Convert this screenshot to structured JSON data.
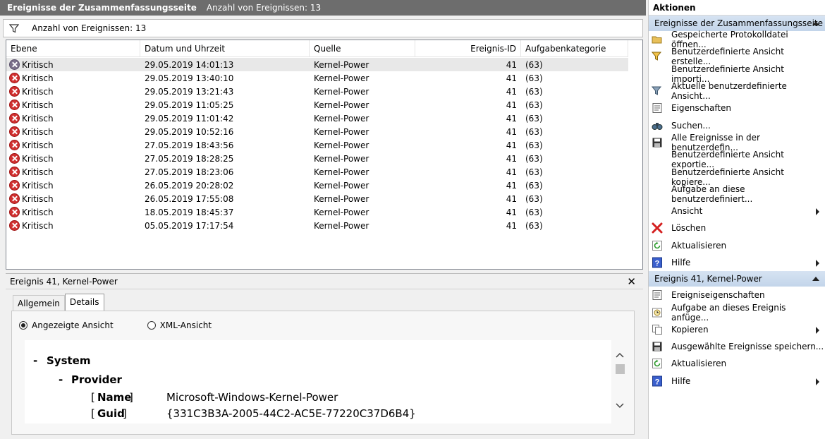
{
  "header": {
    "title": "Ereignisse der Zusammenfassungsseite",
    "count": "Anzahl von Ereignissen: 13"
  },
  "filter": {
    "text": "Anzahl von Ereignissen: 13",
    "icon": "filter-icon"
  },
  "columns": [
    "Ebene",
    "Datum und Uhrzeit",
    "Quelle",
    "Ereignis-ID",
    "Aufgabenkategorie"
  ],
  "events": [
    {
      "level": "Kritisch",
      "date": "29.05.2019 14:01:13",
      "source": "Kernel-Power",
      "id": "41",
      "category": "(63)"
    },
    {
      "level": "Kritisch",
      "date": "29.05.2019 13:40:10",
      "source": "Kernel-Power",
      "id": "41",
      "category": "(63)"
    },
    {
      "level": "Kritisch",
      "date": "29.05.2019 13:21:43",
      "source": "Kernel-Power",
      "id": "41",
      "category": "(63)"
    },
    {
      "level": "Kritisch",
      "date": "29.05.2019 11:05:25",
      "source": "Kernel-Power",
      "id": "41",
      "category": "(63)"
    },
    {
      "level": "Kritisch",
      "date": "29.05.2019 11:01:42",
      "source": "Kernel-Power",
      "id": "41",
      "category": "(63)"
    },
    {
      "level": "Kritisch",
      "date": "29.05.2019 10:52:16",
      "source": "Kernel-Power",
      "id": "41",
      "category": "(63)"
    },
    {
      "level": "Kritisch",
      "date": "27.05.2019 18:43:56",
      "source": "Kernel-Power",
      "id": "41",
      "category": "(63)"
    },
    {
      "level": "Kritisch",
      "date": "27.05.2019 18:28:25",
      "source": "Kernel-Power",
      "id": "41",
      "category": "(63)"
    },
    {
      "level": "Kritisch",
      "date": "27.05.2019 18:23:06",
      "source": "Kernel-Power",
      "id": "41",
      "category": "(63)"
    },
    {
      "level": "Kritisch",
      "date": "26.05.2019 20:28:02",
      "source": "Kernel-Power",
      "id": "41",
      "category": "(63)"
    },
    {
      "level": "Kritisch",
      "date": "26.05.2019 17:55:08",
      "source": "Kernel-Power",
      "id": "41",
      "category": "(63)"
    },
    {
      "level": "Kritisch",
      "date": "18.05.2019 18:45:37",
      "source": "Kernel-Power",
      "id": "41",
      "category": "(63)"
    },
    {
      "level": "Kritisch",
      "date": "05.05.2019 17:17:54",
      "source": "Kernel-Power",
      "id": "41",
      "category": "(63)"
    }
  ],
  "detail": {
    "title": "Ereignis 41, Kernel-Power",
    "close": "✕",
    "tabs": [
      "Allgemein",
      "Details"
    ],
    "radio_friendly": "Angezeigte Ansicht",
    "radio_xml": "XML-Ansicht",
    "xml": {
      "system_dash": "-",
      "system": "System",
      "provider_dash": "-",
      "provider": "Provider",
      "name_open": "[",
      "name_key": "Name",
      "name_close": "]",
      "name_value": "Microsoft-Windows-Kernel-Power",
      "guid_open": "[",
      "guid_key": "Guid",
      "guid_close": "]",
      "guid_value": "{331C3B3A-2005-44C2-AC5E-77220C37D6B4}"
    }
  },
  "actions": {
    "title": "Aktionen",
    "section1": {
      "title": "Ereignisse der Zusammenfassungsseite",
      "items": [
        {
          "label": "Gespeicherte Protokolldatei öffnen...",
          "icon": "folder-icon"
        },
        {
          "label": "Benutzerdefinierte Ansicht erstelle...",
          "icon": "filter-create-icon"
        },
        {
          "label": "Benutzerdefinierte Ansicht importi...",
          "icon": ""
        },
        {
          "label": "Aktuelle benutzerdefinierte Ansicht...",
          "icon": "filter-icon"
        },
        {
          "label": "Eigenschaften",
          "icon": "properties-icon"
        },
        {
          "label": "Suchen...",
          "icon": "binoculars-icon"
        },
        {
          "label": "Alle Ereignisse in der benutzerdefin...",
          "icon": "save-icon"
        },
        {
          "label": "Benutzerdefinierte Ansicht exportie...",
          "icon": ""
        },
        {
          "label": "Benutzerdefinierte Ansicht kopiere...",
          "icon": ""
        },
        {
          "label": "Aufgabe an diese benutzerdefiniert...",
          "icon": ""
        },
        {
          "label": "Ansicht",
          "icon": "",
          "submenu": true
        },
        {
          "label": "Löschen",
          "icon": "delete-icon"
        },
        {
          "label": "Aktualisieren",
          "icon": "refresh-icon"
        },
        {
          "label": "Hilfe",
          "icon": "help-icon",
          "submenu": true
        }
      ]
    },
    "section2": {
      "title": "Ereignis 41, Kernel-Power",
      "items": [
        {
          "label": "Ereigniseigenschaften",
          "icon": "properties-icon"
        },
        {
          "label": "Aufgabe an dieses Ereignis anfüge...",
          "icon": "task-icon"
        },
        {
          "label": "Kopieren",
          "icon": "copy-icon",
          "submenu": true
        },
        {
          "label": "Ausgewählte Ereignisse speichern...",
          "icon": "save-icon"
        },
        {
          "label": "Aktualisieren",
          "icon": "refresh-icon"
        },
        {
          "label": "Hilfe",
          "icon": "help-icon",
          "submenu": true
        }
      ]
    }
  }
}
